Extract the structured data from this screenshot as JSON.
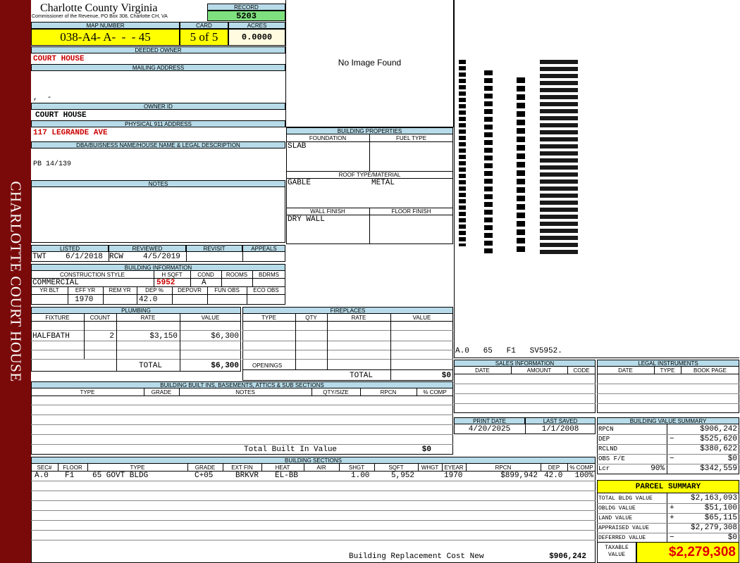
{
  "sidebar": {
    "label": "CHARLOTTE COURT HOUSE",
    "color": "#7a0a0a"
  },
  "header": {
    "county": "Charlotte County Virginia",
    "commissioner": "Commissioner of the Revenue, PO Box 308, Charlotte CH, VA",
    "record_label": "RECORD",
    "record": "5203",
    "map_number_label": "MAP NUMBER",
    "map_number": "038-A4- A-  -  - 45",
    "card_label": "CARD",
    "card": "5 of 5",
    "acres_label": "ACRES",
    "acres": "0.0000"
  },
  "owner": {
    "deeded_owner_label": "DEEDED OWNER",
    "deeded_owner": "COURT HOUSE",
    "mailing_address_label": "MAILING ADDRESS",
    "mailing_line": ",  -",
    "owner_id_label": "OWNER ID",
    "owner_id": "COURT HOUSE",
    "physical_label": "PHYSICAL 911 ADDRESS",
    "physical": "117 LEGRANDE AVE",
    "dba_label": "DBA/BUISNESS NAME/HOUSE NAME & LEGAL DESCRIPTION",
    "dba": "PB 14/139",
    "notes_label": "NOTES"
  },
  "image": {
    "no_image": "No Image Found"
  },
  "sketch": {
    "caption": "A.0   65   F1   SV5952."
  },
  "building_properties": {
    "title": "BUILDING PROPERTIES",
    "foundation_label": "FOUNDATION",
    "foundation": "SLAB",
    "fuel_label": "FUEL TYPE",
    "fuel": "",
    "roof_label": "ROOF TYPE/MATERIAL",
    "roof_type": "GABLE",
    "roof_material": "METAL",
    "wall_label": "WALL FINISH",
    "wall": "DRY WALL",
    "floor_label": "FLOOR FINISH",
    "floor": ""
  },
  "review": {
    "listed_label": "LISTED",
    "listed_by": "TWT",
    "listed_date": "6/1/2018",
    "reviewed_label": "REVIEWED",
    "reviewed_by": "RCW",
    "reviewed_date": "4/5/2019",
    "revisit_label": "REVISIT",
    "appeals_label": "APPEALS"
  },
  "building_info": {
    "title": "BUILDING INFORMATION",
    "style_label": "CONSTRUCTION STYLE",
    "style": "COMMERCIAL",
    "hsqft_label": "H SQFT",
    "hsqft": "5952",
    "cond_label": "COND",
    "cond": "A",
    "rooms_label": "ROOMS",
    "bdrms_label": "BDRMS",
    "yrblt_label": "YR BLT",
    "effyr_label": "EFF YR",
    "effyr": "1970",
    "remyr_label": "REM YR",
    "dep_label": "DEP %",
    "dep": "42.0",
    "depovr_label": "DEPOVR",
    "funobs_label": "FUN OBS",
    "ecoobs_label": "ECO OBS"
  },
  "plumbing": {
    "title": "PLUMBING",
    "cols": [
      "FIXTURE",
      "COUNT",
      "RATE",
      "VALUE"
    ],
    "rows": [
      {
        "fixture": "HALFBATH",
        "count": "2",
        "rate": "$3,150",
        "value": "$6,300"
      }
    ],
    "total_label": "TOTAL",
    "total": "$6,300"
  },
  "fireplaces": {
    "title": "FIREPLACES",
    "cols": [
      "TYPE",
      "QTY",
      "RATE",
      "VALUE"
    ],
    "openings_label": "OPENINGS",
    "total_label": "TOTAL",
    "total": "$0"
  },
  "built_ins": {
    "title": "BUILDING BUILT INS, BASEMENTS, ATTICS & SUB SECTIONS",
    "cols": [
      "TYPE",
      "GRADE",
      "NOTES",
      "QTY/SIZE",
      "RPCN",
      "% COMP"
    ],
    "total_label": "Total Built In Value",
    "total": "$0"
  },
  "sales": {
    "title": "SALES INFORMATION",
    "cols": [
      "DATE",
      "AMOUNT",
      "CODE"
    ]
  },
  "legal": {
    "title": "LEGAL INSTRUMENTS",
    "cols": [
      "DATE",
      "TYPE",
      "BOOK PAGE"
    ]
  },
  "dates": {
    "print_label": "PRINT DATE",
    "print": "4/20/2025",
    "saved_label": "LAST SAVED",
    "saved": "1/1/2008"
  },
  "value_summary": {
    "title": "BUILDING VALUE SUMMARY",
    "rpcn_label": "RPCN",
    "rpcn": "$906,242",
    "dep_label": "DEP",
    "dep_sign": "−",
    "dep": "$525,620",
    "rclnd_label": "RCLND",
    "rclnd": "$380,622",
    "obs_label": "OBS F/E",
    "obs_sign": "−",
    "obs": "$0",
    "lcr_label": "Lcr",
    "lcr_pct": "90%",
    "lcr": "$342,559"
  },
  "parcel": {
    "title": "PARCEL SUMMARY",
    "bldg_label": "TOTAL BLDG VALUE",
    "bldg": "$2,163,093",
    "obldg_label": "OBLDG VALUE",
    "obldg_sign": "+",
    "obldg": "$51,100",
    "land_label": "LAND VALUE",
    "land_sign": "+",
    "land": "$65,115",
    "appraised_label": "APPRAISED VALUE",
    "appraised": "$2,279,308",
    "deferred_label": "DEFERRED VALUE",
    "deferred_sign": "−",
    "deferred": "$0",
    "taxable_label1": "TAXABLE",
    "taxable_label2": "VALUE",
    "taxable": "$2,279,308"
  },
  "sections": {
    "title": "BUILDING SECTIONS",
    "cols": [
      "SEC#",
      "FLOOR",
      "TYPE",
      "GRADE",
      "EXT FIN",
      "HEAT",
      "AIR",
      "SHGT",
      "SQFT",
      "WHGT",
      "EYEAR",
      "RPCN",
      "DEP",
      "% COMP"
    ],
    "row": {
      "sec": "A.0",
      "floor": "F1",
      "type": "65 GOVT BLDG",
      "grade": "C+05",
      "extfin": "BRKVR",
      "heat": "EL-BB",
      "air": "",
      "shgt": "1.00",
      "sqft": "5,952",
      "whgt": "",
      "eyear": "1970",
      "rpcn": "$899,942",
      "dep": "42.0",
      "comp": "100%"
    },
    "footer_label": "Building Replacement Cost New",
    "footer": "$906,242"
  }
}
